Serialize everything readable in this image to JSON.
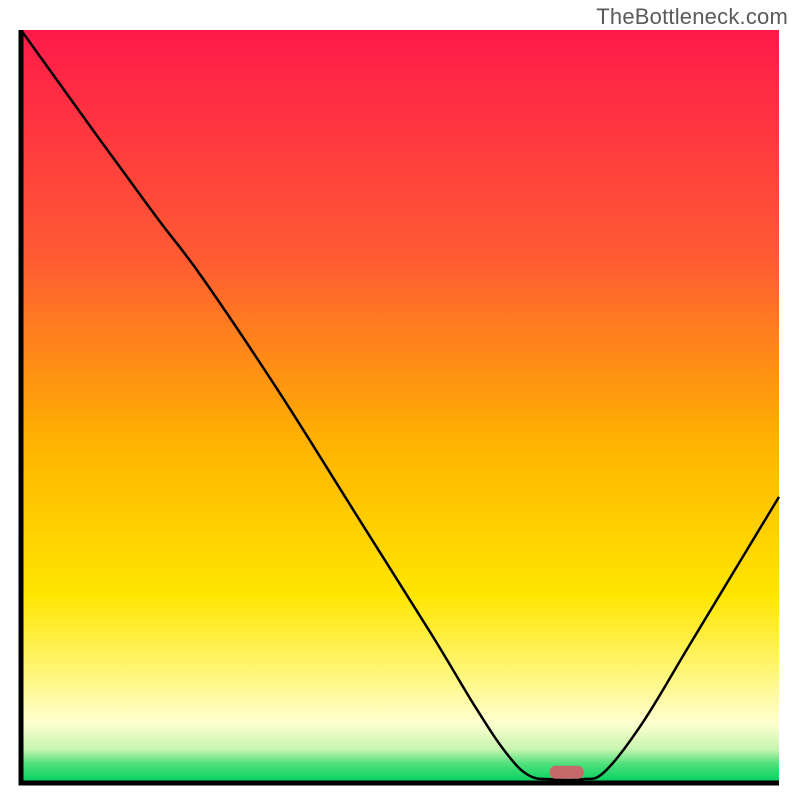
{
  "watermark": "TheBottleneck.com",
  "chart_data": {
    "type": "line",
    "title": "",
    "xlabel": "",
    "ylabel": "",
    "xlim": [
      0,
      100
    ],
    "ylim": [
      0,
      100
    ],
    "background_gradient_stops": [
      {
        "offset": 0.0,
        "color": "#ff1a4a"
      },
      {
        "offset": 0.3,
        "color": "#ff5a33"
      },
      {
        "offset": 0.55,
        "color": "#ffb300"
      },
      {
        "offset": 0.75,
        "color": "#ffe600"
      },
      {
        "offset": 0.86,
        "color": "#fff780"
      },
      {
        "offset": 0.92,
        "color": "#ffffd0"
      },
      {
        "offset": 0.955,
        "color": "#c7f5b0"
      },
      {
        "offset": 0.975,
        "color": "#4de07a"
      },
      {
        "offset": 1.0,
        "color": "#00d060"
      }
    ],
    "series": [
      {
        "name": "curve",
        "points": [
          {
            "x": 0,
            "y": 100
          },
          {
            "x": 10,
            "y": 86
          },
          {
            "x": 18,
            "y": 75
          },
          {
            "x": 24,
            "y": 67
          },
          {
            "x": 34,
            "y": 52
          },
          {
            "x": 44,
            "y": 36
          },
          {
            "x": 54,
            "y": 20
          },
          {
            "x": 60,
            "y": 10
          },
          {
            "x": 64,
            "y": 4
          },
          {
            "x": 67,
            "y": 1
          },
          {
            "x": 70,
            "y": 0.5
          },
          {
            "x": 74,
            "y": 0.5
          },
          {
            "x": 77,
            "y": 1.5
          },
          {
            "x": 82,
            "y": 8
          },
          {
            "x": 88,
            "y": 18
          },
          {
            "x": 94,
            "y": 28
          },
          {
            "x": 100,
            "y": 38
          }
        ]
      }
    ],
    "marker": {
      "x": 72,
      "y": 1.5
    },
    "axis_color": "#000000",
    "line_color": "#000000",
    "marker_color": "#c56a6a"
  }
}
